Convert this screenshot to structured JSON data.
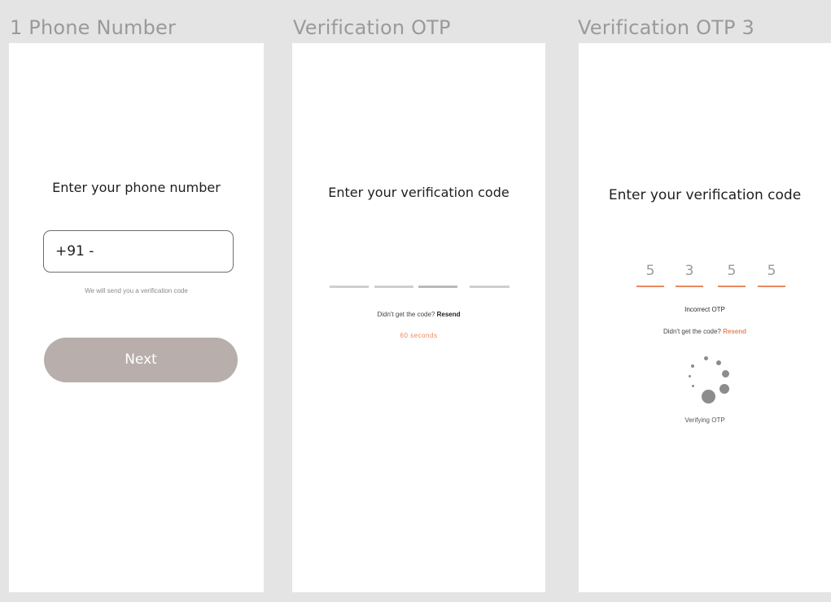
{
  "frames": [
    {
      "title": "1 Phone Number",
      "heading": "Enter your phone number",
      "phone_value": "+91 -",
      "hint": "We will send you a verification code",
      "next_label": "Next"
    },
    {
      "title": "Verification OTP",
      "heading": "Enter your verification code",
      "resend_prompt": "Didn't get the code?",
      "resend_label": "Resend",
      "timer": "60 seconds"
    },
    {
      "title": "Verification OTP 3",
      "heading": "Enter your verification code",
      "otp_digits": [
        "5",
        "3",
        "5",
        "5"
      ],
      "error": "Incorrect OTP",
      "resend_prompt": "Didn't get the code?",
      "resend_label": "Resend",
      "status": "Verifying OTP"
    }
  ],
  "colors": {
    "accent": "#e8895e",
    "button": "#b8aeab",
    "canvas": "#e4e4e4",
    "frame_title": "#9a9a9a"
  },
  "icons": [
    "loading-spinner-icon"
  ]
}
